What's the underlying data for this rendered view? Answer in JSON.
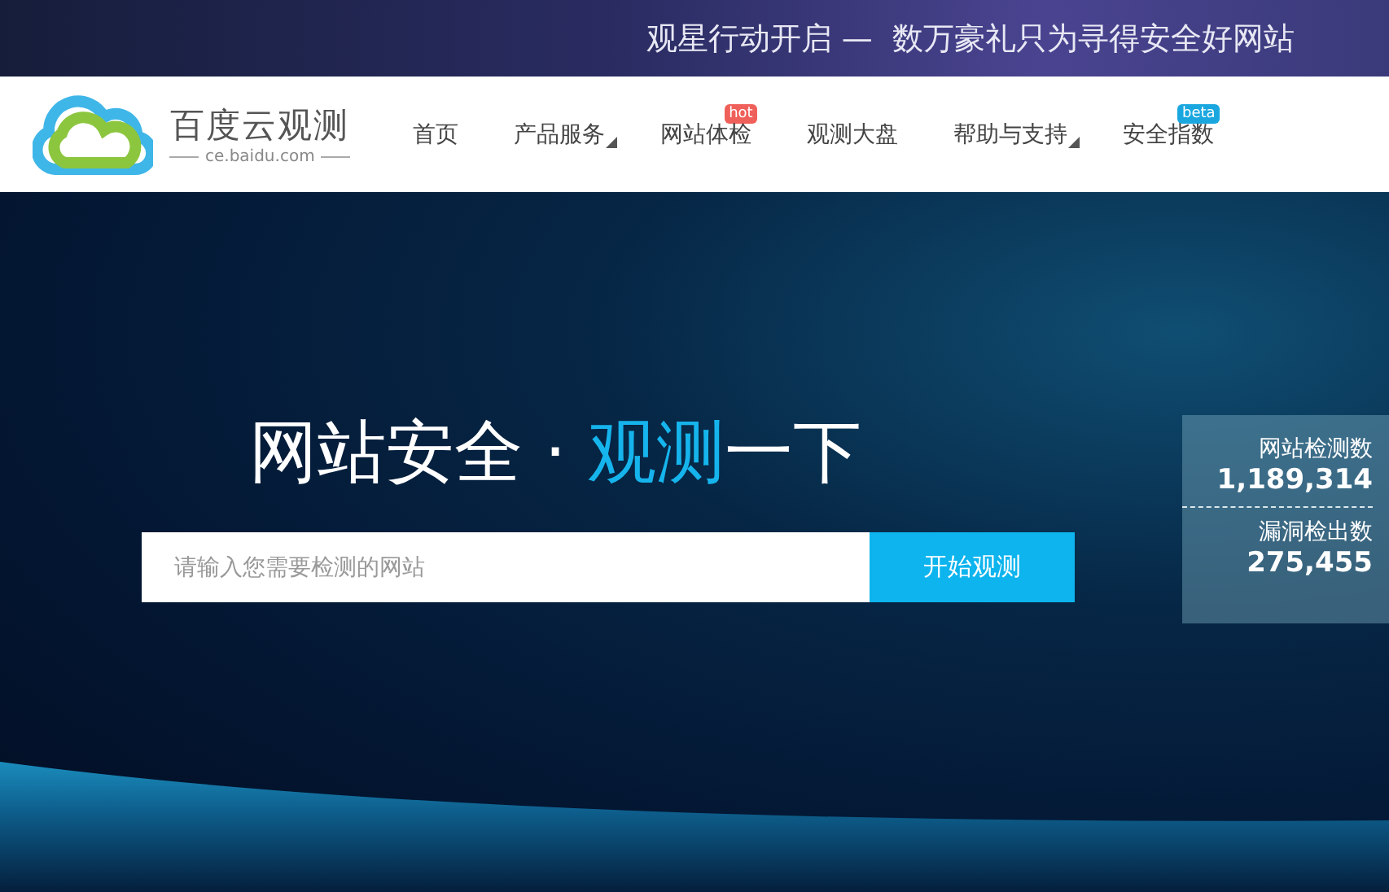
{
  "banner": {
    "text": "观星行动开启 —  数万豪礼只为寻得安全好网站"
  },
  "logo": {
    "name": "百度云观测",
    "domain": "ce.baidu.com"
  },
  "nav": [
    {
      "label": "首页",
      "kind": "link"
    },
    {
      "label": "产品服务",
      "kind": "dropdown"
    },
    {
      "label": "网站体检",
      "kind": "link",
      "badge": {
        "text": "hot",
        "color": "#f0605a"
      }
    },
    {
      "label": "观测大盘",
      "kind": "link"
    },
    {
      "label": "帮助与支持",
      "kind": "dropdown"
    },
    {
      "label": "安全指数",
      "kind": "link",
      "badge": {
        "text": "beta",
        "color": "#1aa7e0"
      }
    }
  ],
  "headline": {
    "parts": [
      {
        "text": "网站安全",
        "highlight": false
      },
      {
        "text": " · ",
        "highlight": false
      },
      {
        "text": "观测",
        "highlight": true
      },
      {
        "text": "一下",
        "highlight": false
      }
    ]
  },
  "search": {
    "placeholder": "请输入您需要检测的网站",
    "button": "开始观测"
  },
  "stats": [
    {
      "label": "网站检测数",
      "value": "1,189,314"
    },
    {
      "label": "漏洞检出数",
      "value": "275,455"
    }
  ]
}
